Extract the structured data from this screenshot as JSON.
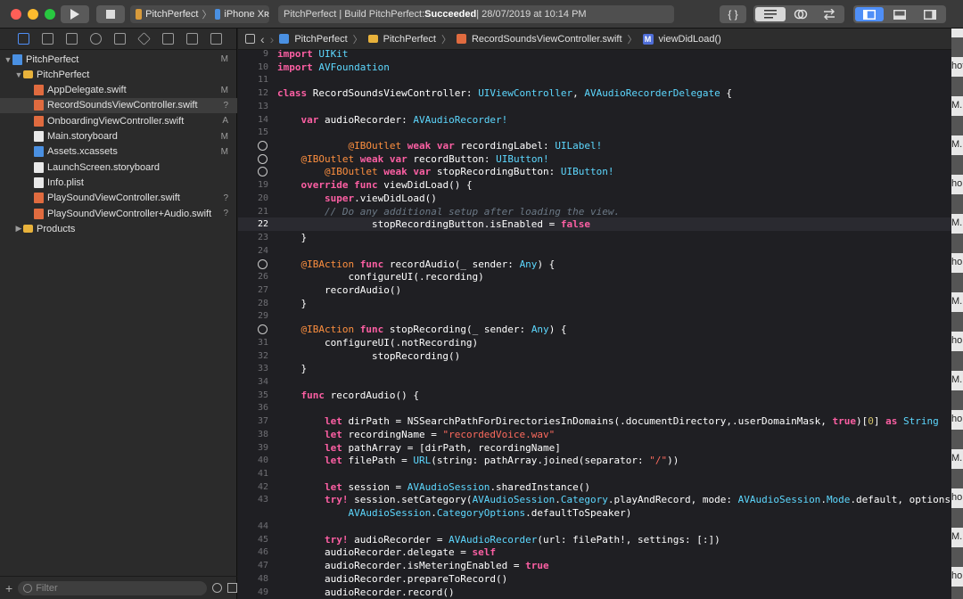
{
  "toolbar": {
    "scheme_project": "PitchPerfect",
    "scheme_device": "iPhone Xʀ",
    "status_prefix": "PitchPerfect | Build PitchPerfect: ",
    "status_result": "Succeeded",
    "status_suffix": " | 28/07/2019 at 10:14 PM",
    "code_review_label": "{ }"
  },
  "navigator": {
    "items": [
      {
        "label": "PitchPerfect",
        "badge": "M",
        "indent": 0,
        "icon": "project",
        "disclosure": "▼"
      },
      {
        "label": "PitchPerfect",
        "badge": "",
        "indent": 1,
        "icon": "folder",
        "disclosure": "▼"
      },
      {
        "label": "AppDelegate.swift",
        "badge": "M",
        "indent": 2,
        "icon": "swift",
        "disclosure": ""
      },
      {
        "label": "RecordSoundsViewController.swift",
        "badge": "?",
        "indent": 2,
        "icon": "swift",
        "disclosure": ""
      },
      {
        "label": "OnboardingViewController.swift",
        "badge": "A",
        "indent": 2,
        "icon": "swift",
        "disclosure": ""
      },
      {
        "label": "Main.storyboard",
        "badge": "M",
        "indent": 2,
        "icon": "storyboard",
        "disclosure": ""
      },
      {
        "label": "Assets.xcassets",
        "badge": "M",
        "indent": 2,
        "icon": "assets",
        "disclosure": ""
      },
      {
        "label": "LaunchScreen.storyboard",
        "badge": "",
        "indent": 2,
        "icon": "storyboard",
        "disclosure": ""
      },
      {
        "label": "Info.plist",
        "badge": "",
        "indent": 2,
        "icon": "plist",
        "disclosure": ""
      },
      {
        "label": "PlaySoundViewController.swift",
        "badge": "?",
        "indent": 2,
        "icon": "swift",
        "disclosure": ""
      },
      {
        "label": "PlaySoundViewController+Audio.swift",
        "badge": "?",
        "indent": 2,
        "icon": "swift",
        "disclosure": ""
      },
      {
        "label": "Products",
        "badge": "",
        "indent": 1,
        "icon": "folder",
        "disclosure": "▶"
      }
    ],
    "selected_index": 3,
    "filter_placeholder": "Filter"
  },
  "jumpbar": {
    "crumbs": [
      "PitchPerfect",
      "PitchPerfect",
      "RecordSoundsViewController.swift",
      "viewDidLoad()"
    ]
  },
  "editor": {
    "current_line": "22",
    "lines": [
      {
        "n": "9",
        "t": "import UIKit"
      },
      {
        "n": "10",
        "t": "import AVFoundation"
      },
      {
        "n": "11",
        "t": ""
      },
      {
        "n": "12",
        "t": "class RecordSoundsViewController: UIViewController, AVAudioRecorderDelegate {"
      },
      {
        "n": "13",
        "t": ""
      },
      {
        "n": "14",
        "t": "    var audioRecorder: AVAudioRecorder!"
      },
      {
        "n": "15",
        "t": ""
      },
      {
        "n": "16",
        "t": "            @IBOutlet weak var recordingLabel: UILabel!"
      },
      {
        "n": "17",
        "t": "    @IBOutlet weak var recordButton: UIButton!"
      },
      {
        "n": "18",
        "t": "        @IBOutlet weak var stopRecordingButton: UIButton!"
      },
      {
        "n": "19",
        "t": "    override func viewDidLoad() {"
      },
      {
        "n": "20",
        "t": "        super.viewDidLoad()"
      },
      {
        "n": "21",
        "t": "        // Do any additional setup after loading the view."
      },
      {
        "n": "22",
        "t": "                stopRecordingButton.isEnabled = false"
      },
      {
        "n": "23",
        "t": "    }"
      },
      {
        "n": "24",
        "t": ""
      },
      {
        "n": "25",
        "t": "    @IBAction func recordAudio(_ sender: Any) {"
      },
      {
        "n": "26",
        "t": "            configureUI(.recording)"
      },
      {
        "n": "27",
        "t": "        recordAudio()"
      },
      {
        "n": "28",
        "t": "    }"
      },
      {
        "n": "29",
        "t": ""
      },
      {
        "n": "30",
        "t": "    @IBAction func stopRecording(_ sender: Any) {"
      },
      {
        "n": "31",
        "t": "        configureUI(.notRecording)"
      },
      {
        "n": "32",
        "t": "                stopRecording()"
      },
      {
        "n": "33",
        "t": "    }"
      },
      {
        "n": "34",
        "t": ""
      },
      {
        "n": "35",
        "t": "    func recordAudio() {"
      },
      {
        "n": "36",
        "t": ""
      },
      {
        "n": "37",
        "t": "        let dirPath = NSSearchPathForDirectoriesInDomains(.documentDirectory,.userDomainMask, true)[0] as String"
      },
      {
        "n": "38",
        "t": "        let recordingName = \"recordedVoice.wav\""
      },
      {
        "n": "39",
        "t": "        let pathArray = [dirPath, recordingName]"
      },
      {
        "n": "40",
        "t": "        let filePath = URL(string: pathArray.joined(separator: \"/\"))"
      },
      {
        "n": "41",
        "t": ""
      },
      {
        "n": "42",
        "t": "        let session = AVAudioSession.sharedInstance()"
      },
      {
        "n": "43",
        "t": "        try! session.setCategory(AVAudioSession.Category.playAndRecord, mode: AVAudioSession.Mode.default, options:"
      },
      {
        "n": "",
        "t": "            AVAudioSession.CategoryOptions.defaultToSpeaker)"
      },
      {
        "n": "44",
        "t": ""
      },
      {
        "n": "45",
        "t": "        try! audioRecorder = AVAudioRecorder(url: filePath!, settings: [:])"
      },
      {
        "n": "46",
        "t": "        audioRecorder.delegate = self"
      },
      {
        "n": "47",
        "t": "        audioRecorder.isMeteringEnabled = true"
      },
      {
        "n": "48",
        "t": "        audioRecorder.prepareToRecord()"
      },
      {
        "n": "49",
        "t": "        audioRecorder.record()"
      }
    ],
    "outlet_lines": [
      "16",
      "17",
      "18",
      "25",
      "30"
    ]
  },
  "side_window": {
    "snippets": [
      "hot",
      "M.",
      "M.",
      "ho",
      "M.",
      "ho",
      "M.",
      "ho",
      "M.",
      "ho",
      "M.",
      "ho",
      "M.",
      "ho",
      "M."
    ]
  },
  "colors": {
    "keyword": "#fc5fa3",
    "type": "#5dd8ff",
    "attribute": "#fd8f3f",
    "string": "#fc6a5d",
    "number": "#d0bf69",
    "comment": "#6c7986",
    "accent": "#4f8ff7"
  }
}
